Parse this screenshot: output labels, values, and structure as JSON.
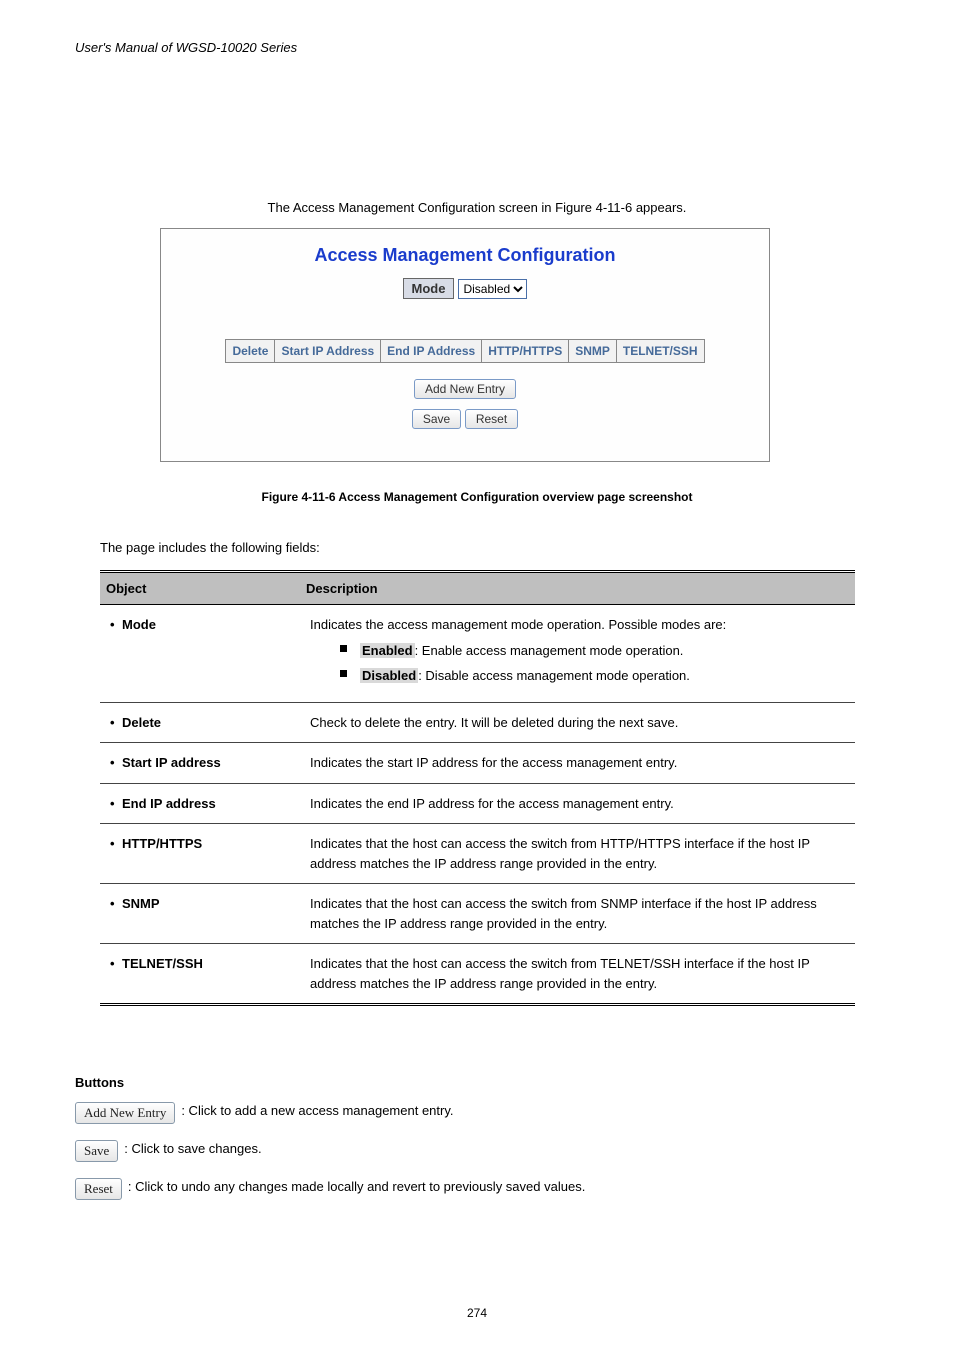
{
  "header": {
    "left": "User's Manual of WGSD-10020 Series",
    "right": ""
  },
  "caption_top": "The Access Management Configuration screen in Figure 4-11-6 appears.",
  "panel": {
    "title": "Access Management Configuration",
    "mode_label": "Mode",
    "mode_value": "Disabled",
    "columns": [
      "Delete",
      "Start IP Address",
      "End IP Address",
      "HTTP/HTTPS",
      "SNMP",
      "TELNET/SSH"
    ],
    "btn_add": "Add New Entry",
    "btn_save": "Save",
    "btn_reset": "Reset"
  },
  "figure_caption": "Figure 4-11-6 Access Management Configuration overview page screenshot",
  "table_intro": "The page includes the following fields:",
  "table": {
    "head_object": "Object",
    "head_desc": "Description",
    "rows": [
      {
        "object": "Mode",
        "desc_intro": "Indicates the access management mode operation. Possible modes are:",
        "opts": [
          {
            "k": "Enabled",
            "t": ": Enable access management mode operation."
          },
          {
            "k": "Disabled",
            "t": ": Disable access management mode operation."
          }
        ]
      },
      {
        "object": "Delete",
        "desc": "Check to delete the entry. It will be deleted during the next save."
      },
      {
        "object": "Start IP address",
        "desc": "Indicates the start IP address for the access management entry."
      },
      {
        "object": "End IP address",
        "desc": "Indicates the end IP address for the access management entry."
      },
      {
        "object": "HTTP/HTTPS",
        "desc": "Indicates that the host can access the switch from HTTP/HTTPS interface if the host IP address matches the IP address range provided in the entry."
      },
      {
        "object": "SNMP",
        "desc": "Indicates that the host can access the switch from SNMP interface if the host IP address matches the IP address range provided in the entry."
      },
      {
        "object": "TELNET/SSH",
        "desc": "Indicates that the host can access the switch from TELNET/SSH interface if the host IP address matches the IP address range provided in the entry."
      }
    ]
  },
  "buttons_section": {
    "heading": "Buttons",
    "items": [
      {
        "label": "Add New Entry",
        "desc": ": Click to add a new access management entry."
      },
      {
        "label": "Save",
        "desc": ": Click to save changes."
      },
      {
        "label": "Reset",
        "desc": ": Click to undo any changes made locally and revert to previously saved values."
      }
    ]
  },
  "page_number": "274"
}
